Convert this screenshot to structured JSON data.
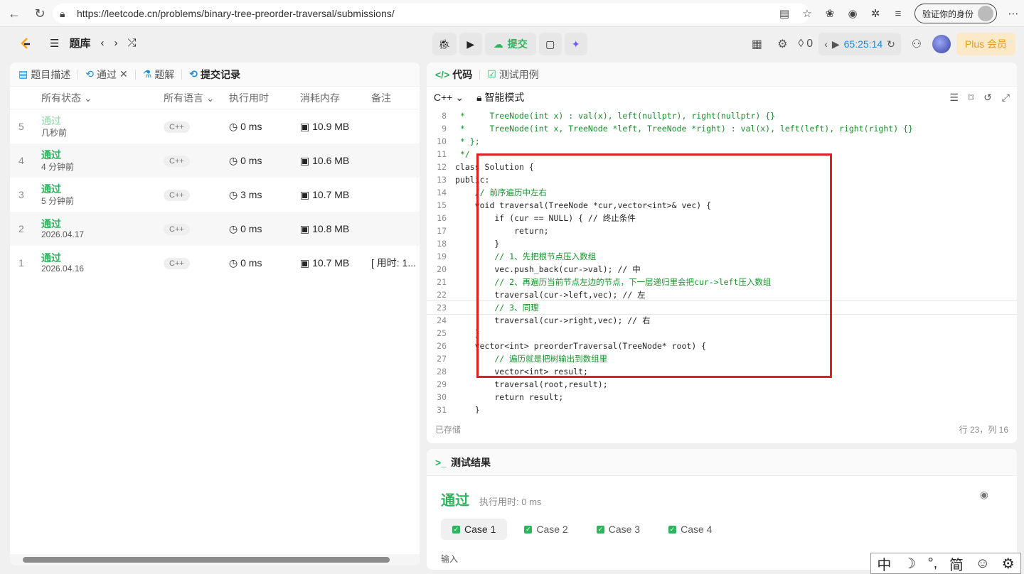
{
  "browser": {
    "url": "https://leetcode.cn/problems/binary-tree-preorder-traversal/submissions/",
    "verify_label": "验证你的身份"
  },
  "topbar": {
    "bank_label": "题库",
    "submit_label": "提交",
    "points": "0",
    "timer": "65:25:14",
    "plus_label": "Plus 会员"
  },
  "left_tabs": [
    {
      "label": "题目描述"
    },
    {
      "label": "通过"
    },
    {
      "label": "题解"
    },
    {
      "label": "提交记录"
    }
  ],
  "table": {
    "headers": {
      "status": "所有状态",
      "lang": "所有语言",
      "time": "执行用时",
      "mem": "消耗内存",
      "note": "备注"
    },
    "rows": [
      {
        "idx": "5",
        "status": "通过",
        "when": "几秒前",
        "lang": "C++",
        "time": "0 ms",
        "mem": "10.9 MB",
        "note": ""
      },
      {
        "idx": "4",
        "status": "通过",
        "when": "4 分钟前",
        "lang": "C++",
        "time": "0 ms",
        "mem": "10.6 MB",
        "note": ""
      },
      {
        "idx": "3",
        "status": "通过",
        "when": "5 分钟前",
        "lang": "C++",
        "time": "3 ms",
        "mem": "10.7 MB",
        "note": ""
      },
      {
        "idx": "2",
        "status": "通过",
        "when": "2026.04.17",
        "lang": "C++",
        "time": "0 ms",
        "mem": "10.8 MB",
        "note": ""
      },
      {
        "idx": "1",
        "status": "通过",
        "when": "2026.04.16",
        "lang": "C++",
        "time": "0 ms",
        "mem": "10.7 MB",
        "note": "[ 用时: 1..."
      }
    ]
  },
  "code_tabs": {
    "code": "代码",
    "tests": "测试用例"
  },
  "editor": {
    "language": "C++",
    "mode": "智能模式",
    "saved": "已存储",
    "cursor": "行 23，列 16"
  },
  "code_lines": [
    {
      "n": "8",
      "t": " *     TreeNode(int x) : val(x), left(nullptr), right(nullptr) {}"
    },
    {
      "n": "9",
      "t": " *     TreeNode(int x, TreeNode *left, TreeNode *right) : val(x), left(left), right(right) {}"
    },
    {
      "n": "10",
      "t": " * };"
    },
    {
      "n": "11",
      "t": " */"
    },
    {
      "n": "12",
      "t": "class Solution {"
    },
    {
      "n": "13",
      "t": "public:"
    },
    {
      "n": "14",
      "t": "    // 前序遍历中左右"
    },
    {
      "n": "15",
      "t": "    void traversal(TreeNode *cur,vector<int>& vec) {"
    },
    {
      "n": "16",
      "t": "        if (cur == NULL) { // 终止条件"
    },
    {
      "n": "17",
      "t": "            return;"
    },
    {
      "n": "18",
      "t": "        }"
    },
    {
      "n": "19",
      "t": "        // 1、先把根节点压入数组"
    },
    {
      "n": "20",
      "t": "        vec.push_back(cur->val); // 中"
    },
    {
      "n": "21",
      "t": "        // 2、再遍历当前节点左边的节点，下一层递归里会把cur->left压入数组"
    },
    {
      "n": "22",
      "t": "        traversal(cur->left,vec); // 左"
    },
    {
      "n": "23",
      "t": "        // 3、同理"
    },
    {
      "n": "24",
      "t": "        traversal(cur->right,vec); // 右"
    },
    {
      "n": "25",
      "t": "    }"
    },
    {
      "n": "26",
      "t": "    vector<int> preorderTraversal(TreeNode* root) {"
    },
    {
      "n": "27",
      "t": "        // 遍历就是把树输出到数组里"
    },
    {
      "n": "28",
      "t": "        vector<int> result;"
    },
    {
      "n": "29",
      "t": "        traversal(root,result);"
    },
    {
      "n": "30",
      "t": "        return result;"
    },
    {
      "n": "31",
      "t": "    }"
    }
  ],
  "result": {
    "title": "测试结果",
    "status": "通过",
    "runtime": "执行用时: 0 ms",
    "cases": [
      "Case 1",
      "Case 2",
      "Case 3",
      "Case 4"
    ],
    "input_label": "输入"
  },
  "ime": [
    "中",
    "☽",
    "°,",
    "简",
    "☺",
    "⚙"
  ],
  "colors": {
    "accent_green": "#2db55d",
    "timer_blue": "#1a8cd8",
    "highlight_red": "#e02020"
  }
}
